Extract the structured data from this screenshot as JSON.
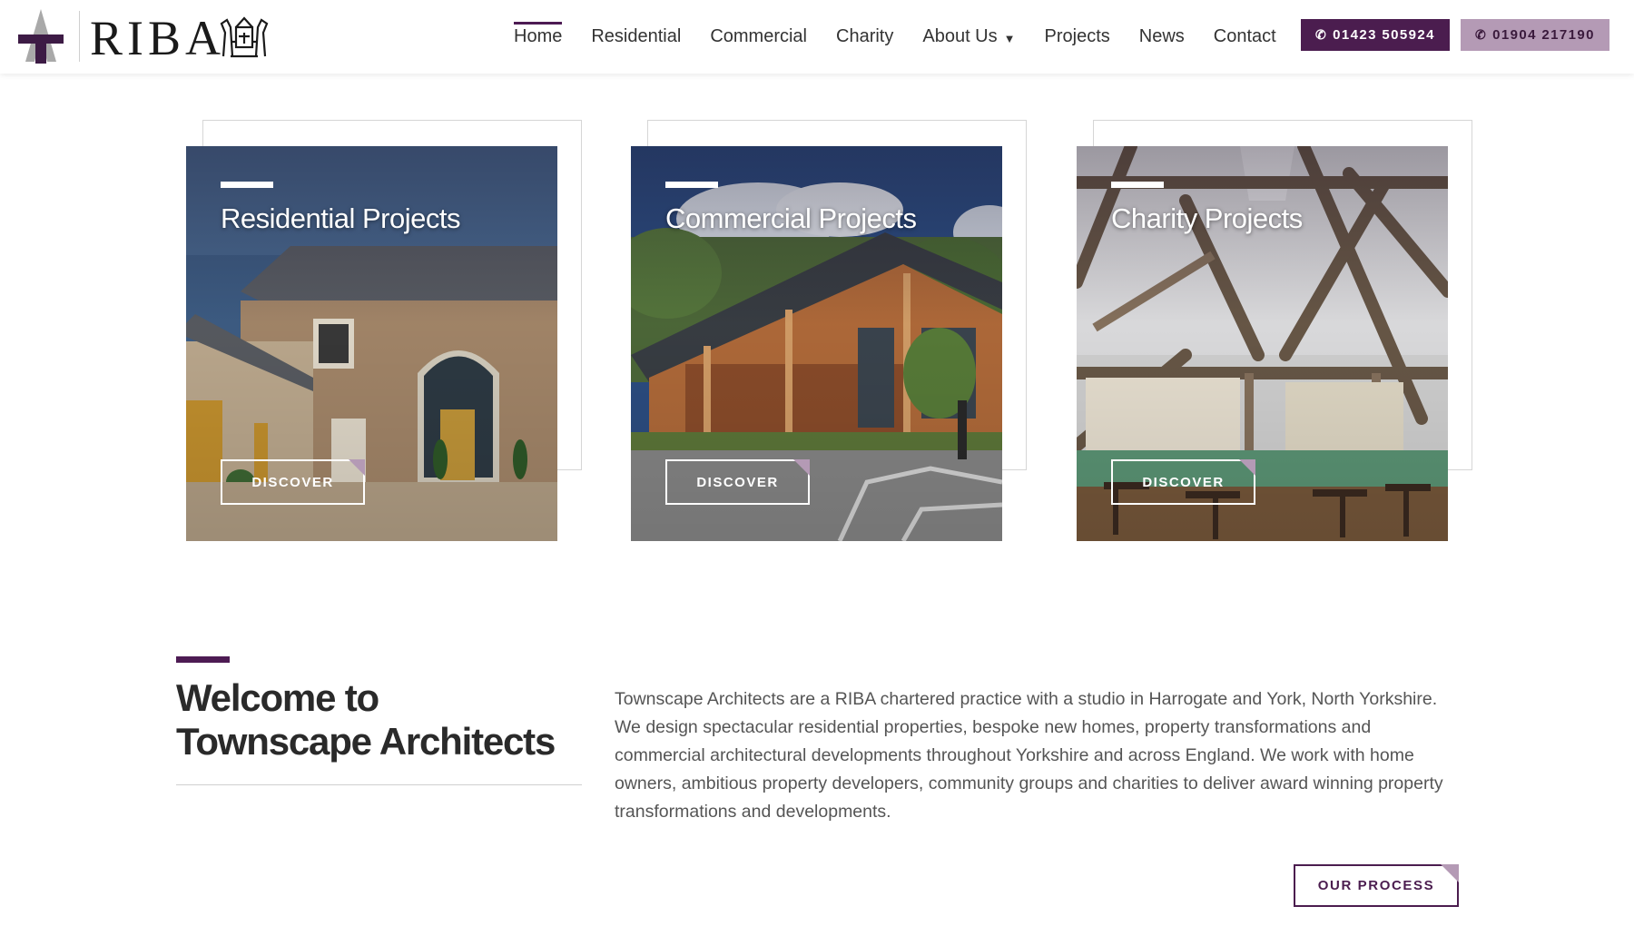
{
  "header": {
    "logo_text": "RIBA",
    "nav": [
      {
        "label": "Home",
        "active": true
      },
      {
        "label": "Residential"
      },
      {
        "label": "Commercial"
      },
      {
        "label": "Charity"
      },
      {
        "label": "About Us",
        "dropdown": true
      },
      {
        "label": "Projects"
      },
      {
        "label": "News"
      },
      {
        "label": "Contact"
      }
    ],
    "phone_1": "01423 505924",
    "phone_2": "01904 217190",
    "phone_icon": "phone-icon"
  },
  "cards": [
    {
      "title": "Residential Projects",
      "button": "DISCOVER",
      "image": "stone-barn-conversion-photo"
    },
    {
      "title": "Commercial Projects",
      "button": "DISCOVER",
      "image": "timber-commercial-building-photo"
    },
    {
      "title": "Charity Projects",
      "button": "DISCOVER",
      "image": "oak-beam-cafe-interior-photo"
    }
  ],
  "welcome": {
    "title": "Welcome to Townscape Architects",
    "body": "Townscape Architects are a RIBA chartered practice with a studio in Harrogate and York, North Yorkshire. We design spectacular residential properties, bespoke new homes, property transformations and commercial architectural developments throughout Yorkshire and across England. We work with home owners, ambitious property developers, community groups and charities to deliver award winning property transformations and developments.",
    "button": "OUR PROCESS"
  },
  "colors": {
    "brand_purple": "#4b1d4f",
    "accent_lilac": "#b49ab5"
  }
}
